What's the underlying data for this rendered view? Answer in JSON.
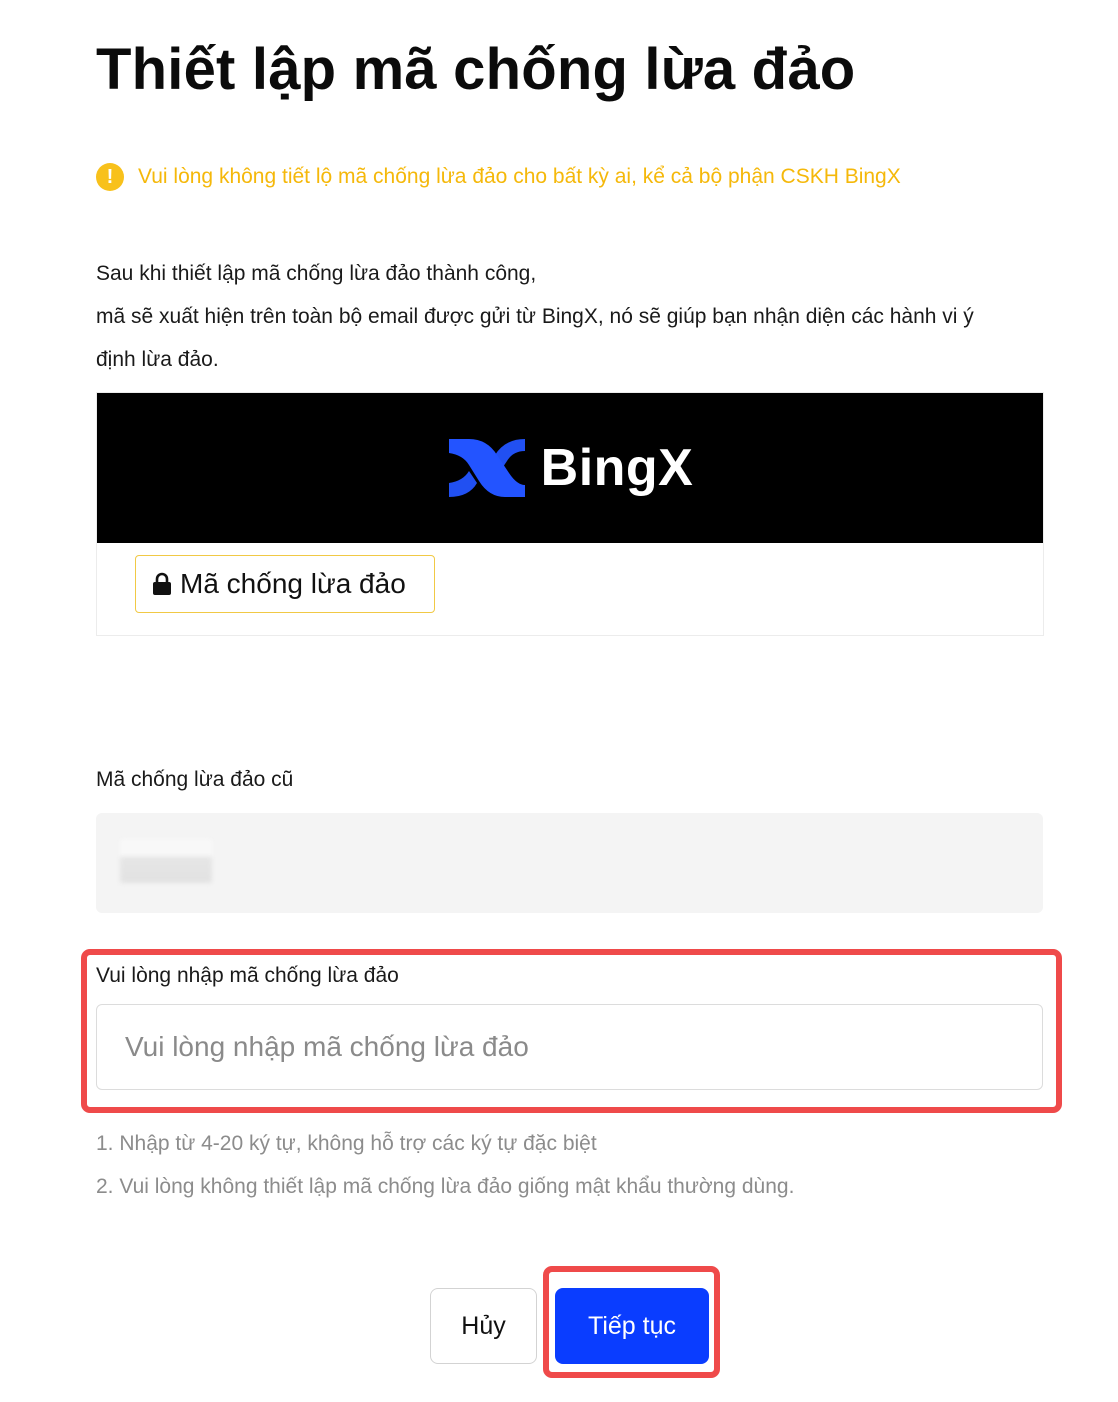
{
  "page": {
    "title": "Thiết lập mã chống lừa đảo"
  },
  "warning": {
    "icon": "info-icon",
    "text": "Vui lòng không tiết lộ mã chống lừa đảo cho bất kỳ ai, kể cả bộ phận CSKH BingX",
    "color": "#f5b80a"
  },
  "description": {
    "line1": "Sau khi thiết lập mã chống lừa đảo thành công,",
    "line2": "mã sẽ xuất hiện trên toàn bộ email được gửi từ BingX, nó sẽ giúp bạn nhận diện các hành vi ý",
    "line3": "định lừa đảo."
  },
  "email_preview": {
    "brand": "BingX",
    "brand_color": "#2354ff",
    "code_chip_label": "Mã chống lừa đảo",
    "chip_icon": "lock-icon"
  },
  "old_code": {
    "label": "Mã chống lừa đảo cũ"
  },
  "new_code": {
    "label": "Vui lòng nhập mã chống lừa đảo",
    "placeholder": "Vui lòng nhập mã chống lừa đảo",
    "value": ""
  },
  "rules": {
    "rule1": "1. Nhập từ 4-20 ký tự, không hỗ trợ các ký tự đặc biệt",
    "rule2": "2. Vui lòng không thiết lập mã chống lừa đảo giống mật khẩu thường dùng."
  },
  "actions": {
    "cancel_label": "Hủy",
    "continue_label": "Tiếp tục",
    "primary_color": "#0a3dff"
  },
  "annotations": {
    "highlight_color": "#ef4a4a"
  }
}
